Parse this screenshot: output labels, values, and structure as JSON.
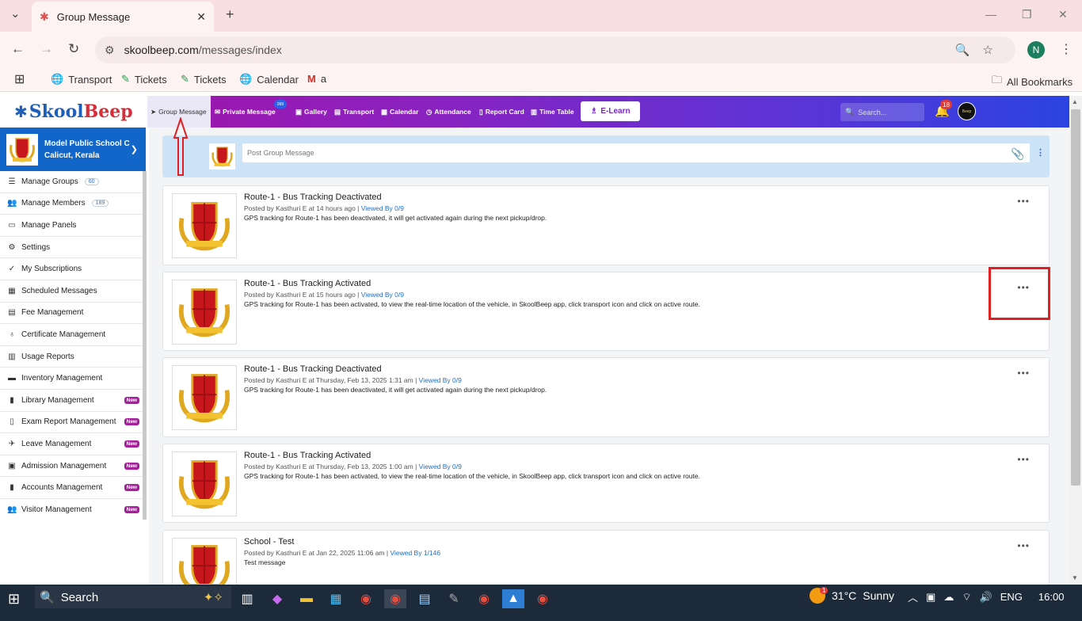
{
  "browser": {
    "tab_title": "Group Message",
    "url_domain": "skoolbeep.com",
    "url_path": "/messages/index",
    "avatar_letter": "N",
    "bookmarks": [
      {
        "label": "Transport",
        "icon": "globe-icon"
      },
      {
        "label": "Tickets",
        "icon": "tickets-icon"
      },
      {
        "label": "Tickets",
        "icon": "tickets-icon"
      },
      {
        "label": "Calendar",
        "icon": "globe-icon"
      },
      {
        "label": "a",
        "icon": "gmail-icon"
      }
    ],
    "all_bookmarks": "All Bookmarks"
  },
  "app": {
    "logo_part1": "Skool",
    "logo_part2": "Beep",
    "nav": [
      {
        "label": "Group Message",
        "icon": "send-icon"
      },
      {
        "label": "Private Message",
        "icon": "mail-icon"
      },
      {
        "label": "Gallery",
        "icon": "image-icon"
      },
      {
        "label": "Transport",
        "icon": "bus-icon"
      },
      {
        "label": "Calendar",
        "icon": "calendar-icon"
      },
      {
        "label": "Attendance",
        "icon": "clock-icon"
      },
      {
        "label": "Report Card",
        "icon": "report-icon"
      },
      {
        "label": "Time Table",
        "icon": "timetable-icon"
      }
    ],
    "private_badge": "999",
    "elearn": "E-Learn",
    "search_placeholder": "Search...",
    "notif_count": "18",
    "user_avatar_text": "Beep"
  },
  "school": {
    "name": "Model Public School C",
    "location": "Calicut, Kerala"
  },
  "sidebar": [
    {
      "label": "Manage Groups",
      "icon": "list-icon",
      "count": "60"
    },
    {
      "label": "Manage Members",
      "icon": "users-icon",
      "count": "189"
    },
    {
      "label": "Manage Panels",
      "icon": "monitor-icon"
    },
    {
      "label": "Settings",
      "icon": "gear-icon"
    },
    {
      "label": "My Subscriptions",
      "icon": "check-icon"
    },
    {
      "label": "Scheduled Messages",
      "icon": "calendar-icon"
    },
    {
      "label": "Fee Management",
      "icon": "fee-icon"
    },
    {
      "label": "Certificate Management",
      "icon": "certificate-icon"
    },
    {
      "label": "Usage Reports",
      "icon": "chart-icon"
    },
    {
      "label": "Inventory Management",
      "icon": "inventory-icon"
    },
    {
      "label": "Library Management",
      "icon": "book-icon",
      "badge": "New"
    },
    {
      "label": "Exam Report Management",
      "icon": "exam-icon",
      "badge": "New"
    },
    {
      "label": "Leave Management",
      "icon": "leave-icon",
      "badge": "New"
    },
    {
      "label": "Admission Management",
      "icon": "admission-icon",
      "badge": "New"
    },
    {
      "label": "Accounts Management",
      "icon": "accounts-icon",
      "badge": "New"
    },
    {
      "label": "Visitor Management",
      "icon": "visitor-icon",
      "badge": "New"
    }
  ],
  "post_placeholder": "Post Group Message",
  "messages": [
    {
      "title": "Route-1 - Bus Tracking Deactivated",
      "meta": "Posted by Kasthuri E at 14 hours ago",
      "viewed": "Viewed By 0/9",
      "body": "GPS tracking for Route-1 has been deactivated, it will get activated again during the next pickup/drop."
    },
    {
      "title": "Route-1 - Bus Tracking Activated",
      "meta": "Posted by Kasthuri E at 15 hours ago",
      "viewed": "Viewed By 0/9",
      "body": "GPS tracking for Route-1 has been activated, to view the real-time location of the vehicle, in SkoolBeep app, click transport icon and click on active route."
    },
    {
      "title": "Route-1 - Bus Tracking Deactivated",
      "meta": "Posted by Kasthuri E at Thursday, Feb 13, 2025 1:31 am",
      "viewed": "Viewed By 0/9",
      "body": "GPS tracking for Route-1 has been deactivated, it will get activated again during the next pickup/drop."
    },
    {
      "title": "Route-1 - Bus Tracking Activated",
      "meta": "Posted by Kasthuri E at Thursday, Feb 13, 2025 1:00 am",
      "viewed": "Viewed By 0/9",
      "body": "GPS tracking for Route-1 has been activated, to view the real-time location of the vehicle, in SkoolBeep app, click transport icon and click on active route."
    },
    {
      "title": "School - Test",
      "meta": "Posted by Kasthuri E at Jan 22, 2025 11:06 am",
      "viewed": "Viewed By 1/146",
      "body": "Test message"
    }
  ],
  "taskbar": {
    "search": "Search",
    "weather_alert": "1",
    "temp": "31°C",
    "condition": "Sunny",
    "lang": "ENG",
    "time": "16:00"
  },
  "colors": {
    "accent_red": "#e02020",
    "header_start": "#a80fa0",
    "header_end": "#2a44e2",
    "school_blue": "#1266c9",
    "new_badge": "#a81f9d"
  }
}
